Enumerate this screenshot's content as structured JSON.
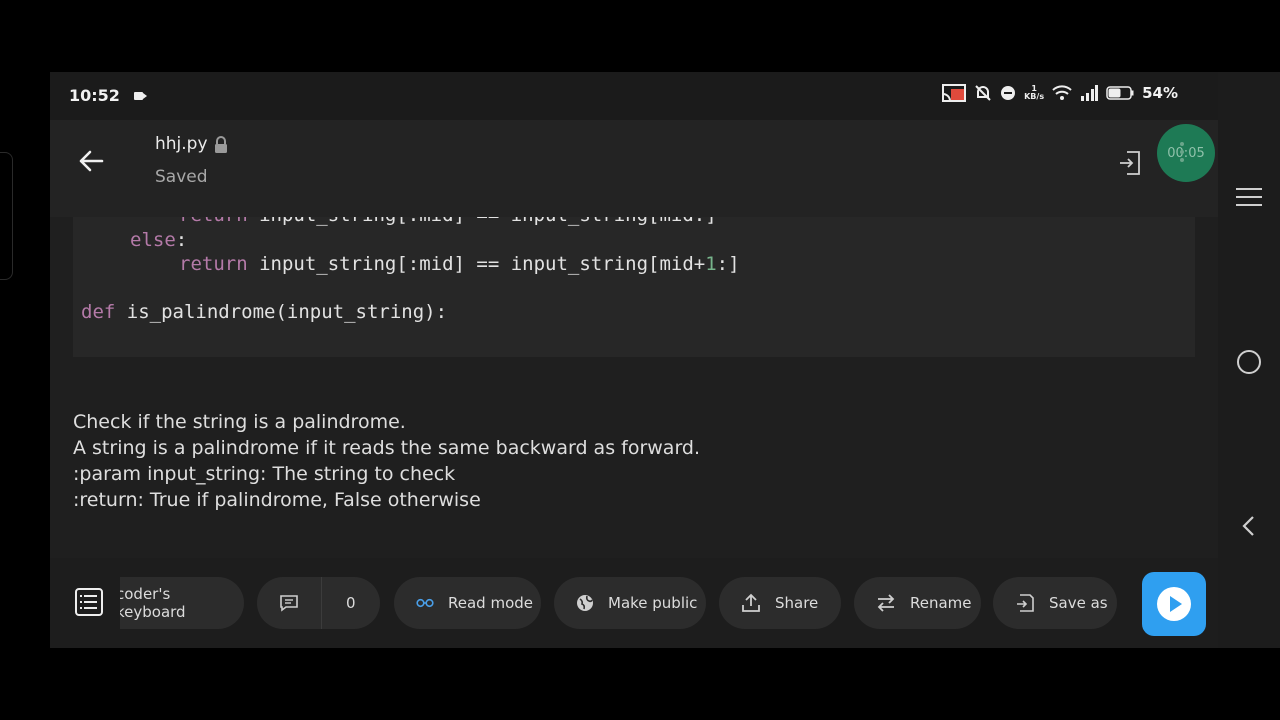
{
  "status": {
    "time": "10:52",
    "net_speed_value": "1",
    "net_speed_unit": "KB/s",
    "battery": "54%"
  },
  "file": {
    "name": "hhj.py",
    "state": "Saved"
  },
  "timer": "00:05",
  "code": {
    "line1": {
      "kw": "return",
      "rest": " input_string[:mid] == input_string[mid:]"
    },
    "line2": {
      "kw": "else",
      "rest": ":"
    },
    "line3": {
      "kw": "return",
      "pre": " input_string[:mid] == input_string[mid+",
      "num": "1",
      "post": ":]"
    },
    "line4": {
      "kw": "def",
      "rest": " is_palindrome(input_string):"
    }
  },
  "docstring": [
    "Check if the string is a palindrome.",
    "A string is a palindrome if it reads the same backward as forward.",
    ":param input_string: The string to check",
    ":return: True if palindrome, False otherwise"
  ],
  "toolbar": {
    "keyboard": "coder's keyboard",
    "comments_count": "0",
    "read_mode": "Read mode",
    "make_public": "Make public",
    "share": "Share",
    "rename": "Rename",
    "save_as": "Save as"
  },
  "colors": {
    "accent": "#2f9ff0",
    "timer": "#1e7a55",
    "keyword": "#b47aa8",
    "number": "#77b48b"
  }
}
